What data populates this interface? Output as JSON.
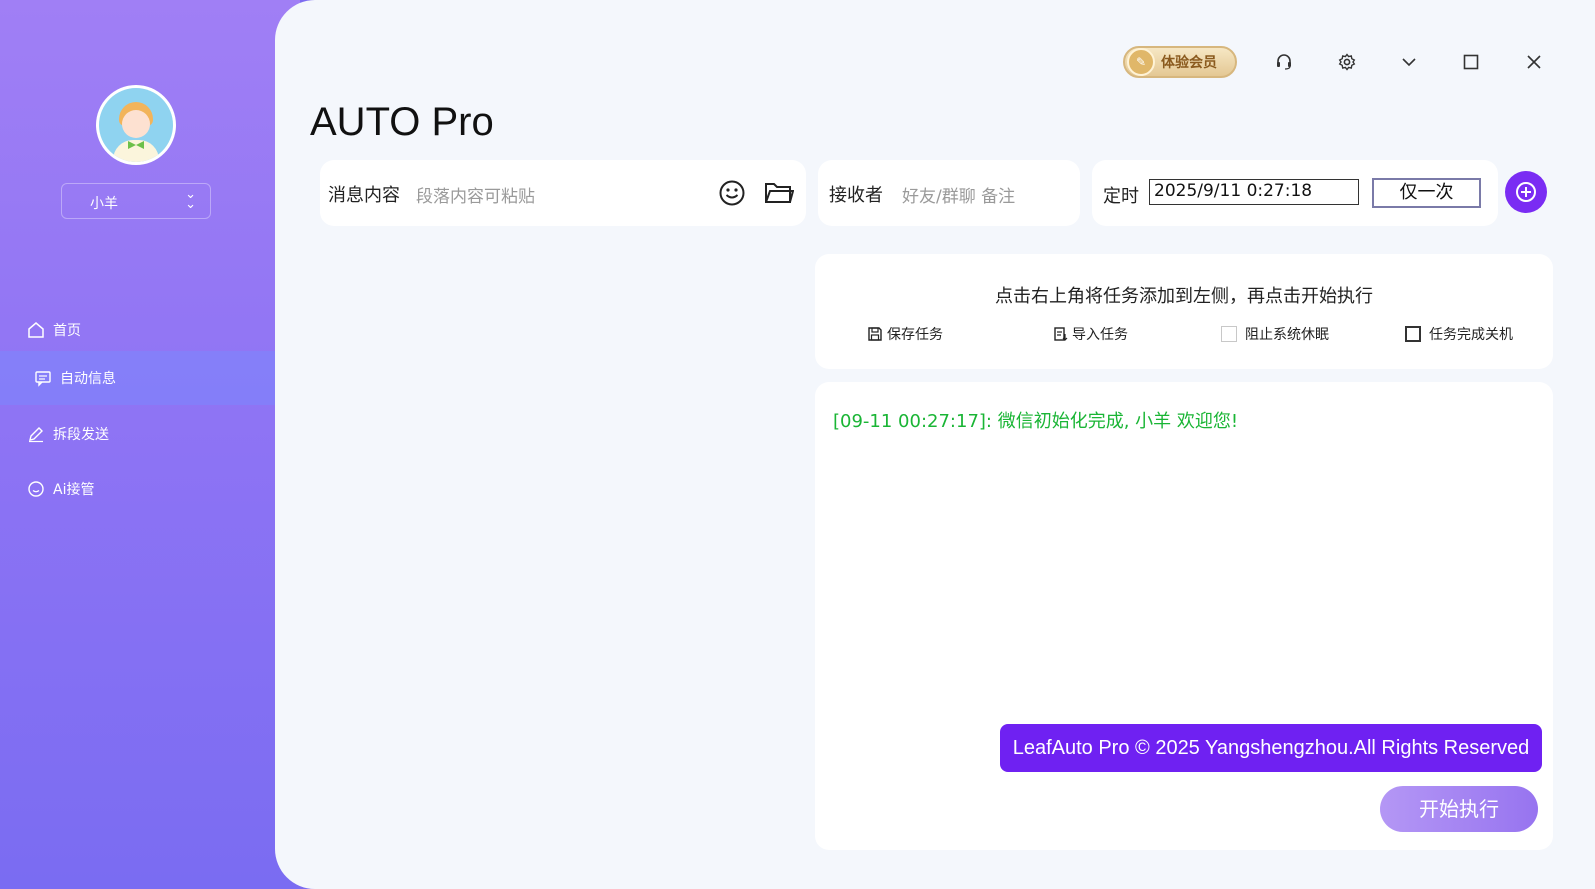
{
  "sidebar": {
    "username": "小羊",
    "nav": [
      {
        "label": "首页",
        "icon": "home-icon"
      },
      {
        "label": "自动信息",
        "icon": "message-icon",
        "active": true
      },
      {
        "label": "拆段发送",
        "icon": "pen-icon"
      },
      {
        "label": "Ai接管",
        "icon": "smile-icon"
      }
    ]
  },
  "header": {
    "vip_label": "体验会员",
    "app_title": "AUTO Pro"
  },
  "compose": {
    "message_label": "消息内容",
    "message_placeholder": "段落内容可粘贴",
    "receiver_label": "接收者",
    "receiver_placeholder": "好友/群聊 备注",
    "schedule_label": "定时",
    "schedule_value": "2025/9/11 0:27:18",
    "repeat_value": "仅一次"
  },
  "tasks": {
    "hint": "点击右上角将任务添加到左侧，再点击开始执行",
    "save_label": "保存任务",
    "import_label": "导入任务",
    "prevent_sleep_label": "阻止系统休眠",
    "shutdown_label": "任务完成关机"
  },
  "log": {
    "line": "[09-11 00:27:17]: 微信初始化完成, 小羊 欢迎您!"
  },
  "footer": {
    "copyright": "LeafAuto Pro © 2025 Yangshengzhou.All Rights Reserved",
    "start_label": "开始执行"
  },
  "colors": {
    "accent": "#6f21f2",
    "log_green": "#1ab535",
    "sidebar_top": "#a07ff5"
  }
}
